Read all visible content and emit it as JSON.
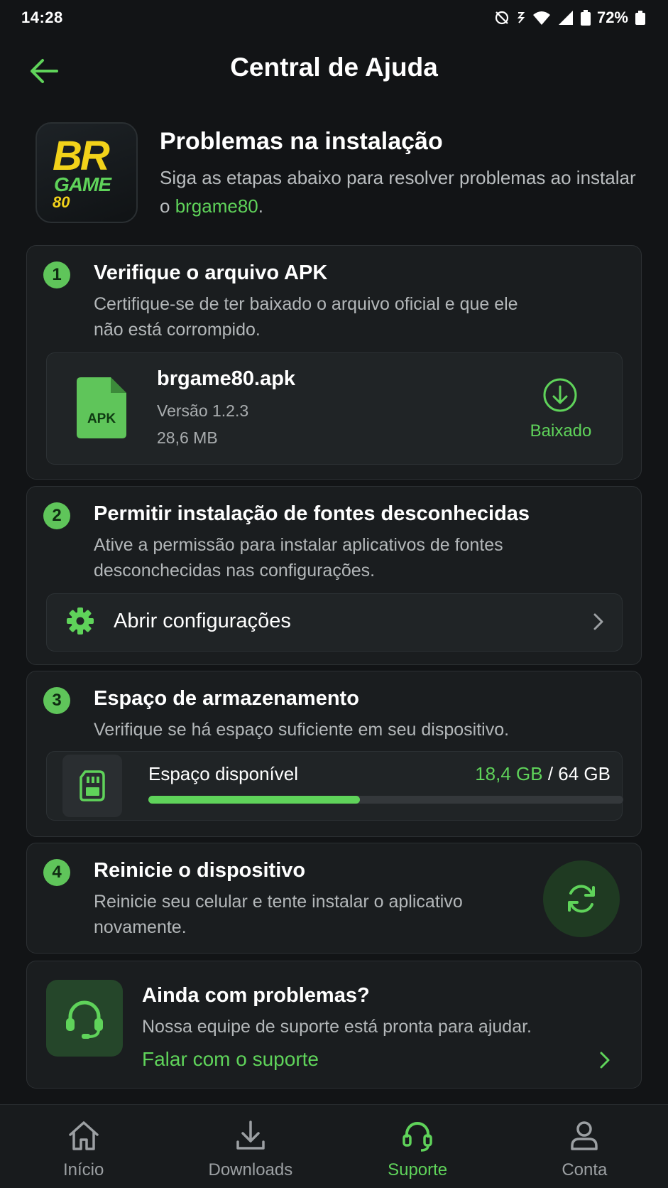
{
  "status_bar": {
    "time": "14:28",
    "battery_pct": "72%"
  },
  "app_bar": {
    "title": "Central de Ajuda",
    "back_icon": "arrow-left-icon"
  },
  "intro": {
    "logo_br": "BR",
    "logo_game": "GAME",
    "logo_80": "80",
    "title": "Problemas na instalação",
    "desc_part1": "Siga as etapas abaixo para resolver problemas ao instalar o ",
    "desc_highlight": "brgame80",
    "desc_part2": "."
  },
  "steps": [
    {
      "num": "1",
      "title": "Verifique o arquivo APK",
      "desc": "Certifique-se de ter baixado o arquivo oficial e que ele não está corrompido.",
      "file": {
        "icon_label": "APK",
        "name": "brgame80.apk",
        "version": "Versão 1.2.3",
        "size": "28,6 MB",
        "status": "Baixado"
      }
    },
    {
      "num": "2",
      "title": "Permitir instalação de fontes desconhecidas",
      "desc": "Ative a permissão para instalar aplicativos de fontes desconchecidas nas configurações.",
      "action_label": "Abrir configurações"
    },
    {
      "num": "3",
      "title": "Espaço de armazenamento",
      "desc": "Verifique se há espaço suficiente em seu dispositivo.",
      "storage": {
        "label": "Espaço disponível",
        "free": "18,4 GB",
        "sep": " / ",
        "total": "64 GB",
        "fill_fraction": 0.445
      }
    },
    {
      "num": "4",
      "title": "Reinicie o dispositivo",
      "desc": "Reinicie seu celular e tente instalar o aplicativo novamente."
    }
  ],
  "support": {
    "title": "Ainda com problemas?",
    "desc": "Nossa equipe de suporte está pronta para ajudar.",
    "link": "Falar com o suporte"
  },
  "bottom_nav": [
    {
      "label": "Início",
      "icon": "home-icon",
      "active": false
    },
    {
      "label": "Downloads",
      "icon": "download-icon",
      "active": false
    },
    {
      "label": "Suporte",
      "icon": "headset-icon",
      "active": true
    },
    {
      "label": "Conta",
      "icon": "user-icon",
      "active": false
    }
  ],
  "colors": {
    "accent": "#5fd35a",
    "background": "#121416",
    "card": "#1a1d1f"
  }
}
